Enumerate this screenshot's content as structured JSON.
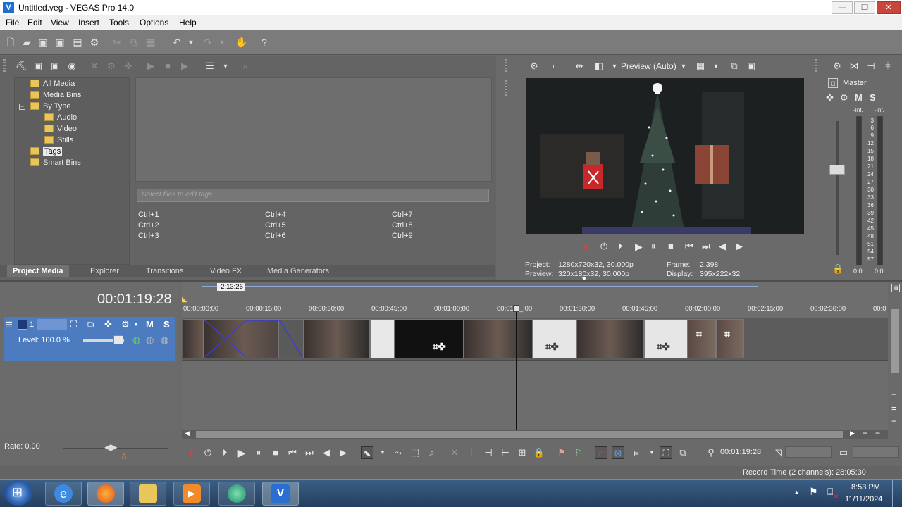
{
  "window": {
    "title": "Untitled.veg - VEGAS Pro 14.0",
    "app_icon_glyph": "V",
    "minimize": "—",
    "maximize": "❐",
    "close": "✕"
  },
  "menu": [
    "File",
    "Edit",
    "View",
    "Insert",
    "Tools",
    "Options",
    "Help"
  ],
  "media_tree": {
    "items": [
      {
        "label": "All Media"
      },
      {
        "label": "Media Bins"
      },
      {
        "label": "By Type",
        "toggle": "−"
      },
      {
        "label": "Audio"
      },
      {
        "label": "Video"
      },
      {
        "label": "Stills"
      },
      {
        "label": "Tags"
      },
      {
        "label": "Smart Bins"
      }
    ]
  },
  "tags": {
    "placeholder": "Select files to edit tags",
    "shortcuts": [
      "Ctrl+1",
      "Ctrl+2",
      "Ctrl+3",
      "Ctrl+4",
      "Ctrl+5",
      "Ctrl+6",
      "Ctrl+7",
      "Ctrl+8",
      "Ctrl+9"
    ]
  },
  "tabs": [
    "Project Media",
    "Explorer",
    "Transitions",
    "Video FX",
    "Media Generators"
  ],
  "preview": {
    "quality": "Preview (Auto)",
    "project_label": "Project:",
    "project_value": "1280x720x32, 30.000p",
    "preview_label": "Preview:",
    "preview_value": "320x180x32, 30.000p",
    "frame_label": "Frame:",
    "frame_value": "2,398",
    "display_label": "Display:",
    "display_value": "395x222x32"
  },
  "mixer": {
    "title": "Master",
    "m": "M",
    "s": "S",
    "inf_left": "-Inf.",
    "inf_right": "-Inf.",
    "scale": [
      "3",
      "6",
      "9",
      "12",
      "15",
      "18",
      "21",
      "24",
      "27",
      "30",
      "33",
      "36",
      "39",
      "42",
      "45",
      "48",
      "51",
      "54",
      "57"
    ],
    "bottom_left": "0.0",
    "bottom_right": "0.0"
  },
  "timeline": {
    "timecode": "00:01:19:28",
    "region_length": "-2:13:26",
    "ruler_ticks": [
      "00:00:00;00",
      "00:00:15;00",
      "00:00:30;00",
      "00:00:45;00",
      "00:01:00;00",
      "00:01:1_:00",
      "00:01:30;00",
      "00:01:45;00",
      "00:02:00;00",
      "00:02:15;00",
      "00:02:30;00",
      "00:0"
    ],
    "track": {
      "number": "1",
      "level": "Level: 100.0 %",
      "m": "M",
      "s": "S"
    },
    "rate": "Rate: 0.00",
    "cursor_timecode": "00:01:19:28"
  },
  "status": {
    "record_time": "Record Time (2 channels): 28:05:30"
  },
  "taskbar": {
    "time": "8:53 PM",
    "date": "11/11/2024"
  }
}
